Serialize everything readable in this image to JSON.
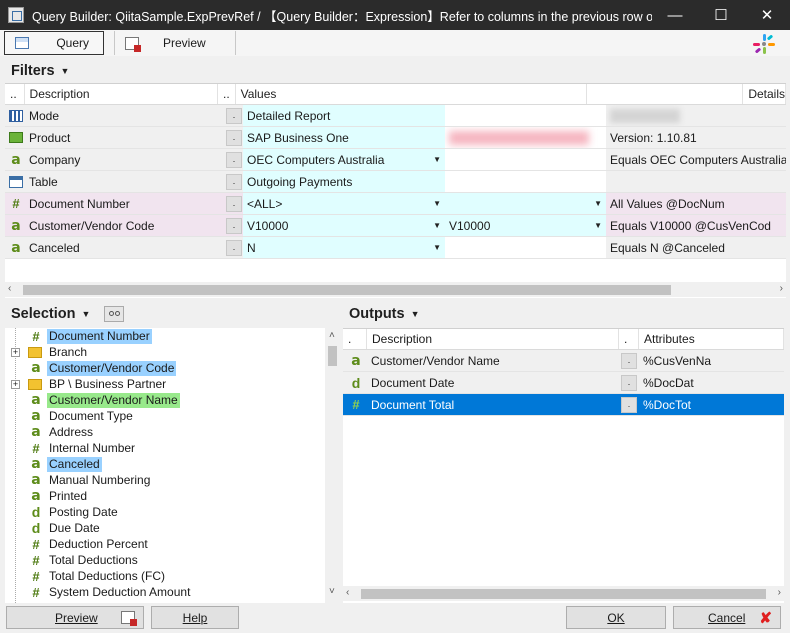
{
  "window": {
    "title": "Query Builder:  QiitaSample.ExpPrevRef / 【Query Builder：Expression】Refer to columns in the previous row of quer...",
    "minimize": "—",
    "maximize": "☐",
    "close": "✕"
  },
  "toolbar": {
    "query_label": "Query",
    "preview_label": "Preview"
  },
  "filters": {
    "header": "Filters",
    "columns": {
      "dots": "..",
      "description": "Description",
      "dots2": "..",
      "values": "Values",
      "details": "Details"
    },
    "rows": [
      {
        "icon": "mode",
        "description": "Mode",
        "dot": ".",
        "value1": "Detailed Report",
        "value2": "",
        "details": ""
      },
      {
        "icon": "product",
        "description": "Product",
        "dot": ".",
        "value1": "SAP Business One",
        "value2": "",
        "details": "Version: 1.10.81"
      },
      {
        "icon": "a",
        "description": "Company",
        "dot": ".",
        "value1": "OEC Computers Australia",
        "value2": "",
        "details": "Equals OEC Computers Australia @C"
      },
      {
        "icon": "table",
        "description": "Table",
        "dot": ".",
        "value1": "Outgoing Payments",
        "value2": "",
        "details": ""
      },
      {
        "icon": "#",
        "description": "Document Number",
        "dot": ".",
        "value1": "<ALL>",
        "value2": "",
        "details": "All Values @DocNum"
      },
      {
        "icon": "a",
        "description": "Customer/Vendor Code",
        "dot": ".",
        "value1": "V10000",
        "value2": "V10000",
        "details": "Equals V10000 @CusVenCod"
      },
      {
        "icon": "a",
        "description": "Canceled",
        "dot": ".",
        "value1": "N",
        "value2": "",
        "details": "Equals N @Canceled"
      }
    ]
  },
  "selection": {
    "header": "Selection",
    "items": [
      {
        "icon": "#",
        "label": "Document Number",
        "highlight": "blue"
      },
      {
        "icon": "folder",
        "label": "Branch",
        "highlight": "",
        "expander": "+"
      },
      {
        "icon": "a",
        "label": "Customer/Vendor Code",
        "highlight": "blue"
      },
      {
        "icon": "folder",
        "label": "BP \\ Business Partner",
        "highlight": "",
        "expander": "+"
      },
      {
        "icon": "a",
        "label": "Customer/Vendor Name",
        "highlight": "green"
      },
      {
        "icon": "a",
        "label": "Document Type",
        "highlight": ""
      },
      {
        "icon": "a",
        "label": "Address",
        "highlight": ""
      },
      {
        "icon": "#",
        "label": "Internal Number",
        "highlight": ""
      },
      {
        "icon": "a",
        "label": "Canceled",
        "highlight": "blue"
      },
      {
        "icon": "a",
        "label": "Manual Numbering",
        "highlight": ""
      },
      {
        "icon": "a",
        "label": "Printed",
        "highlight": ""
      },
      {
        "icon": "d",
        "label": "Posting Date",
        "highlight": ""
      },
      {
        "icon": "d",
        "label": "Due Date",
        "highlight": ""
      },
      {
        "icon": "#",
        "label": "Deduction Percent",
        "highlight": ""
      },
      {
        "icon": "#",
        "label": "Total Deductions",
        "highlight": ""
      },
      {
        "icon": "#",
        "label": "Total Deductions (FC)",
        "highlight": ""
      },
      {
        "icon": "#",
        "label": "System Deduction Amount",
        "highlight": ""
      }
    ]
  },
  "outputs": {
    "header": "Outputs",
    "columns": {
      "dots": ".",
      "description": "Description",
      "dots2": ".",
      "attributes": "Attributes"
    },
    "rows": [
      {
        "icon": "a",
        "description": "Customer/Vendor Name",
        "dot": ".",
        "attribute": "%CusVenNa",
        "selected": false
      },
      {
        "icon": "d",
        "description": "Document Date",
        "dot": ".",
        "attribute": "%DocDat",
        "selected": false
      },
      {
        "icon": "#",
        "description": "Document Total",
        "dot": ".",
        "attribute": "%DocTot",
        "selected": true
      }
    ]
  },
  "buttons": {
    "preview": "Preview",
    "help": "Help",
    "ok": "OK",
    "cancel": "Cancel"
  }
}
